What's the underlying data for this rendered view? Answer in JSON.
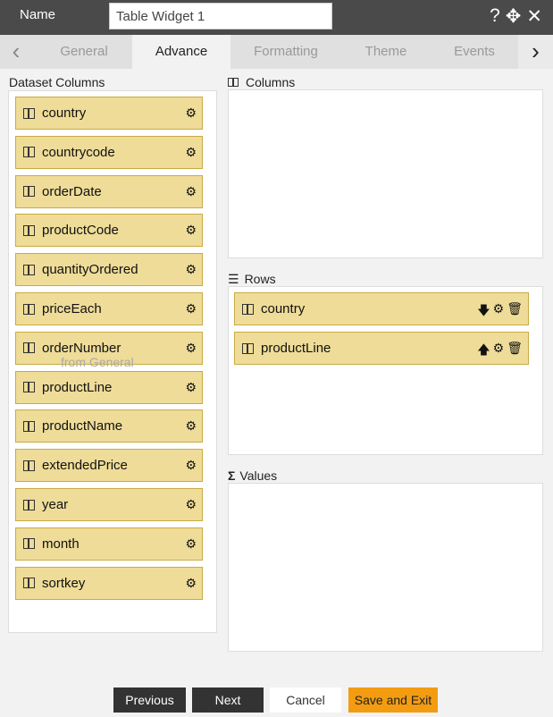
{
  "header": {
    "name_label": "Name",
    "name_value": "Table Widget 1",
    "icons": [
      "help-icon",
      "move-icon",
      "close-icon"
    ]
  },
  "tabs": [
    {
      "label": "General"
    },
    {
      "label": "Advance",
      "active": true
    },
    {
      "label": "Formatting"
    },
    {
      "label": "Theme"
    },
    {
      "label": "Events"
    }
  ],
  "dataset": {
    "title": "Dataset Columns",
    "items": [
      "country",
      "countrycode",
      "orderDate",
      "productCode",
      "quantityOrdered",
      "priceEach",
      "orderNumber",
      "productLine",
      "productName",
      "extendedPrice",
      "year",
      "month",
      "sortkey"
    ],
    "drag_hint": "from General"
  },
  "columns": {
    "title": "Columns"
  },
  "rows": {
    "title": "Rows",
    "items": [
      {
        "label": "country",
        "sort": "down"
      },
      {
        "label": "productLine",
        "sort": "up"
      }
    ]
  },
  "values": {
    "title": "Values"
  },
  "footer": {
    "previous": "Previous",
    "next": "Next",
    "cancel": "Cancel",
    "save": "Save and Exit"
  },
  "colors": {
    "header": "#4a4a4a",
    "item": "#eedc98",
    "save": "#f39c12"
  }
}
